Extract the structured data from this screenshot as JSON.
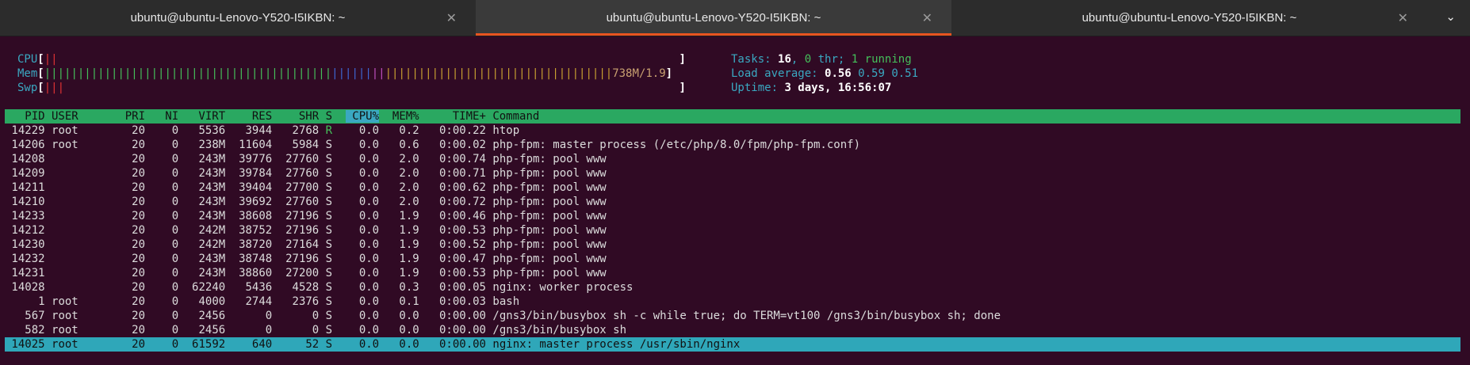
{
  "tabs": [
    {
      "label": "ubuntu@ubuntu-Lenovo-Y520-I5IKBN: ~",
      "active": false
    },
    {
      "label": "ubuntu@ubuntu-Lenovo-Y520-I5IKBN: ~",
      "active": true
    },
    {
      "label": "ubuntu@ubuntu-Lenovo-Y520-I5IKBN: ~",
      "active": false
    }
  ],
  "icons": {
    "close": "close-icon",
    "menu": "chevron-down-icon"
  },
  "meters": {
    "cpu_label": "CPU",
    "mem_label": "Mem",
    "swp_label": "Swp",
    "mem_value": "738M/1.9",
    "tasks_label": "Tasks:",
    "tasks_value": "16",
    "thr_value": "0",
    "thr_label": "thr;",
    "running_value": "1",
    "running_label": "running",
    "load_label": "Load average:",
    "load_1": "0.56",
    "load_5": "0.59",
    "load_15": "0.51",
    "uptime_label": "Uptime:",
    "uptime_value": "3 days, 16:56:07"
  },
  "table": {
    "headers": [
      "PID",
      "USER",
      "PRI",
      "NI",
      "VIRT",
      "RES",
      "SHR",
      "S",
      "CPU%",
      "MEM%",
      "TIME+",
      "Command"
    ],
    "rows": [
      [
        "14229",
        "root",
        "20",
        "0",
        "5536",
        "3944",
        "2768",
        "R",
        "0.0",
        "0.2",
        "0:00.22",
        "htop"
      ],
      [
        "14206",
        "root",
        "20",
        "0",
        "238M",
        "11604",
        "5984",
        "S",
        "0.0",
        "0.6",
        "0:00.02",
        "php-fpm: master process (/etc/php/8.0/fpm/php-fpm.conf)"
      ],
      [
        "14208",
        "",
        "20",
        "0",
        "243M",
        "39776",
        "27760",
        "S",
        "0.0",
        "2.0",
        "0:00.74",
        "php-fpm: pool www"
      ],
      [
        "14209",
        "",
        "20",
        "0",
        "243M",
        "39784",
        "27760",
        "S",
        "0.0",
        "2.0",
        "0:00.71",
        "php-fpm: pool www"
      ],
      [
        "14211",
        "",
        "20",
        "0",
        "243M",
        "39404",
        "27700",
        "S",
        "0.0",
        "2.0",
        "0:00.62",
        "php-fpm: pool www"
      ],
      [
        "14210",
        "",
        "20",
        "0",
        "243M",
        "39692",
        "27760",
        "S",
        "0.0",
        "2.0",
        "0:00.72",
        "php-fpm: pool www"
      ],
      [
        "14233",
        "",
        "20",
        "0",
        "243M",
        "38608",
        "27196",
        "S",
        "0.0",
        "1.9",
        "0:00.46",
        "php-fpm: pool www"
      ],
      [
        "14212",
        "",
        "20",
        "0",
        "242M",
        "38752",
        "27196",
        "S",
        "0.0",
        "1.9",
        "0:00.53",
        "php-fpm: pool www"
      ],
      [
        "14230",
        "",
        "20",
        "0",
        "242M",
        "38720",
        "27164",
        "S",
        "0.0",
        "1.9",
        "0:00.52",
        "php-fpm: pool www"
      ],
      [
        "14232",
        "",
        "20",
        "0",
        "243M",
        "38748",
        "27196",
        "S",
        "0.0",
        "1.9",
        "0:00.47",
        "php-fpm: pool www"
      ],
      [
        "14231",
        "",
        "20",
        "0",
        "243M",
        "38860",
        "27200",
        "S",
        "0.0",
        "1.9",
        "0:00.53",
        "php-fpm: pool www"
      ],
      [
        "14028",
        "",
        "20",
        "0",
        "62240",
        "5436",
        "4528",
        "S",
        "0.0",
        "0.3",
        "0:00.05",
        "nginx: worker process"
      ],
      [
        "1",
        "root",
        "20",
        "0",
        "4000",
        "2744",
        "2376",
        "S",
        "0.0",
        "0.1",
        "0:00.03",
        "bash"
      ],
      [
        "567",
        "root",
        "20",
        "0",
        "2456",
        "0",
        "0",
        "S",
        "0.0",
        "0.0",
        "0:00.00",
        "/gns3/bin/busybox sh -c while true; do TERM=vt100 /gns3/bin/busybox sh; done"
      ],
      [
        "582",
        "root",
        "20",
        "0",
        "2456",
        "0",
        "0",
        "S",
        "0.0",
        "0.0",
        "0:00.00",
        "/gns3/bin/busybox sh"
      ],
      [
        "14025",
        "root",
        "20",
        "0",
        "61592",
        "640",
        "52",
        "S",
        "0.0",
        "0.0",
        "0:00.00",
        "nginx: master process /usr/sbin/nginx"
      ]
    ],
    "selected_row": 15
  },
  "colors": {
    "background": "#300a24",
    "header": "#2aa861",
    "selection": "#2fa7b9",
    "accent_tab": "#e95420"
  }
}
